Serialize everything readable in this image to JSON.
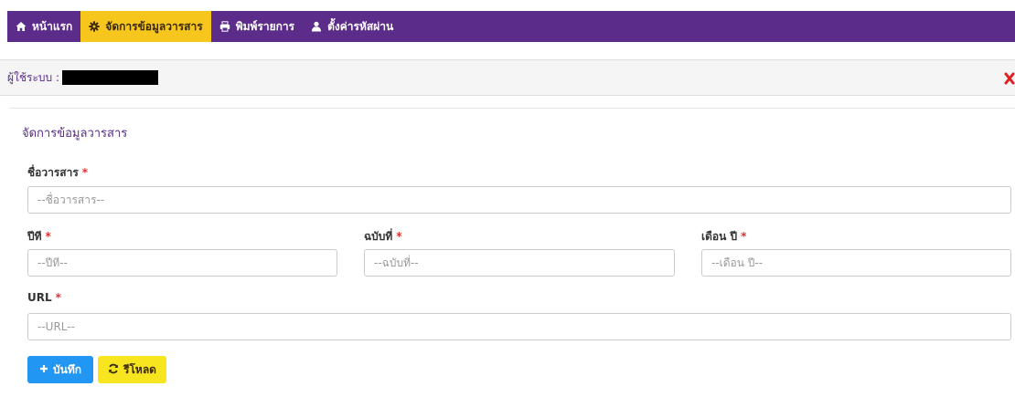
{
  "nav": {
    "items": [
      {
        "label": "หน้าแรก",
        "icon": "home-icon",
        "active": false
      },
      {
        "label": "จัดการข้อมูลวารสาร",
        "icon": "gear-icon",
        "active": true
      },
      {
        "label": "พิมพ์รายการ",
        "icon": "print-icon",
        "active": false
      },
      {
        "label": "ตั้งค่ารหัสผ่าน",
        "icon": "user-icon",
        "active": false
      }
    ]
  },
  "userbar": {
    "label": "ผู้ใช้ระบบ :",
    "logout_icon": "close-icon"
  },
  "form": {
    "title": "จัดการข้อมูลวารสาร",
    "journal_name": {
      "label": "ชื่อวารสาร",
      "required": "*",
      "placeholder": "--ชื่อวารสาร--",
      "value": ""
    },
    "year": {
      "label": "ปีที",
      "required": "*",
      "placeholder": "--ปีที--",
      "value": ""
    },
    "issue": {
      "label": "ฉบับที่",
      "required": "*",
      "placeholder": "--ฉบับที่--",
      "value": ""
    },
    "month_year": {
      "label": "เดือน ปี",
      "required": "*",
      "placeholder": "--เดือน ปี--",
      "value": ""
    },
    "url": {
      "label": "URL",
      "required": "*",
      "placeholder": "--URL--",
      "value": ""
    }
  },
  "buttons": {
    "save_label": "บันทึก",
    "reload_label": "รีโหลด"
  },
  "colors": {
    "nav_bg": "#5b2c8a",
    "nav_active": "#f6c61c",
    "save": "#2196f3",
    "reload": "#f7e51f",
    "required": "#e03030",
    "logout": "#e02020"
  }
}
